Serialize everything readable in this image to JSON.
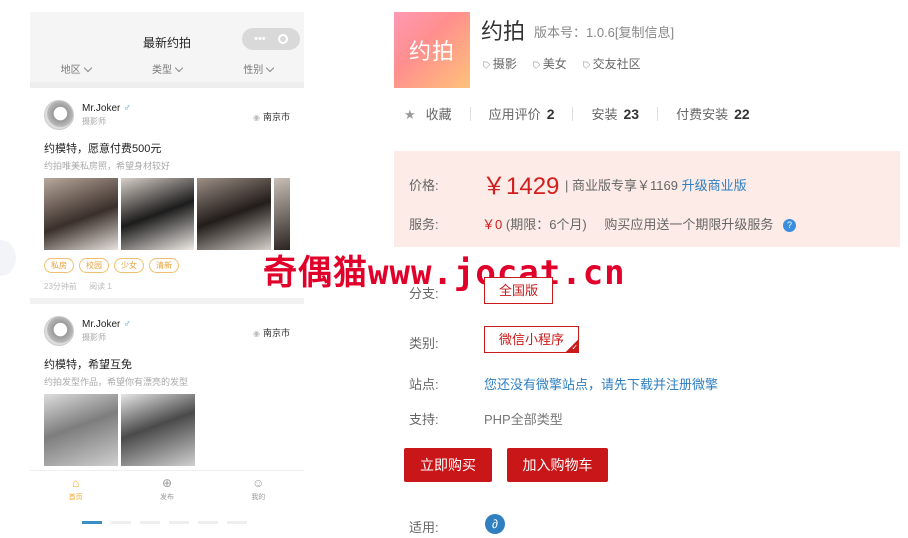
{
  "preview": {
    "nav_title": "最新约拍",
    "capsule_dots": "•••",
    "filters": [
      "地区",
      "类型",
      "性别"
    ],
    "posts": [
      {
        "author": "Mr.Joker",
        "gender_symbol": "♂",
        "role": "摄影师",
        "location": "南京市",
        "title": "约模特，愿意付费500元",
        "subtitle": "约拍唯美私房照，希望身材较好",
        "tags": [
          "私房",
          "校园",
          "少女",
          "清新"
        ],
        "time": "23分钟前",
        "reads": "阅读 1"
      },
      {
        "author": "Mr.Joker",
        "gender_symbol": "♂",
        "role": "摄影师",
        "location": "南京市",
        "title": "约模特，希望互免",
        "subtitle": "约拍发型作品，希望你有漂亮的发型"
      }
    ],
    "tabbar": [
      {
        "label": "首页",
        "icon": "home-icon"
      },
      {
        "label": "发布",
        "icon": "plus-circle-icon"
      },
      {
        "label": "我的",
        "icon": "user-icon"
      }
    ]
  },
  "app": {
    "logo_text": "约拍",
    "name": "约拍",
    "version": "版本号：1.0.6[复制信息]",
    "categories": [
      "摄影",
      "美女",
      "交友社区"
    ]
  },
  "stats": {
    "favorite_label": "收藏",
    "rating_label": "应用评价",
    "rating_value": "2",
    "installs_label": "安装",
    "installs_value": "23",
    "paid_installs_label": "付费安装",
    "paid_installs_value": "22"
  },
  "price": {
    "label": "价格:",
    "value": "￥1429",
    "business_text": "| 商业版专享￥1169",
    "upgrade_link": "升级商业版",
    "service_label": "服务:",
    "service_price": "￥0",
    "service_period": "(期限：6个月)",
    "service_note": "购买应用送一个期限升级服务",
    "help_icon_text": "?"
  },
  "watermark": "奇偶猫www.jocat.cn",
  "options": {
    "branch_label": "分支:",
    "branch_value": "全国版",
    "category_label": "类别:",
    "category_value": "微信小程序",
    "site_label": "站点:",
    "site_text": "您还没有微擎站点，请先下载并注册微擎",
    "support_label": "支持:",
    "support_text": "PHP全部类型",
    "applicable_label": "适用:"
  },
  "buttons": {
    "buy_now": "立即购买",
    "add_to_cart": "加入购物车"
  },
  "colors": {
    "accent_red": "#c91619",
    "link_blue": "#2f7fc1",
    "price_bg": "#fcebe6",
    "tag_orange": "#e6a23c"
  }
}
